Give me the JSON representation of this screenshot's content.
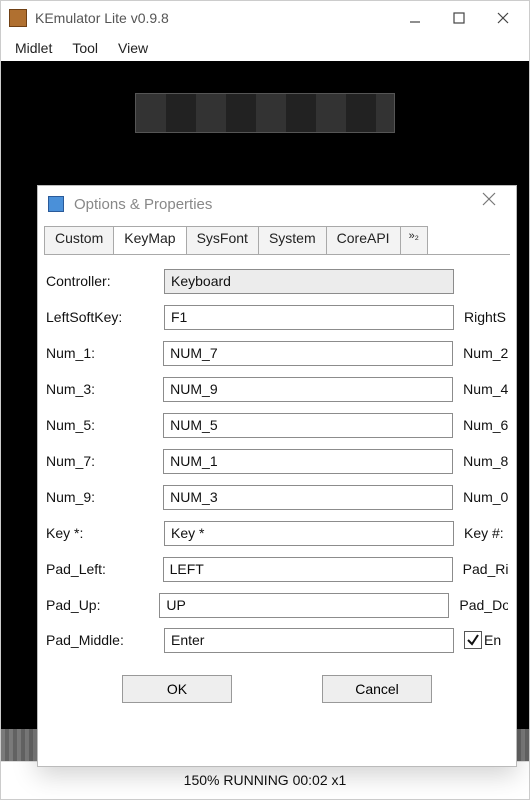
{
  "window": {
    "title": "KEmulator Lite v0.9.8"
  },
  "menubar": {
    "midlet": "Midlet",
    "tool": "Tool",
    "view": "View"
  },
  "statusbar": {
    "text": "150%  RUNNING  00:02  x1"
  },
  "dialog": {
    "title": "Options & Properties",
    "tabs": {
      "custom": "Custom",
      "keymap": "KeyMap",
      "sysfont": "SysFont",
      "system": "System",
      "coreapi": "CoreAPI",
      "more": "»₂"
    },
    "rows": {
      "controller": {
        "label": "Controller:",
        "value": "Keyboard",
        "right": ""
      },
      "leftsoftkey": {
        "label": "LeftSoftKey:",
        "value": "F1",
        "right": "RightS"
      },
      "num1": {
        "label": "Num_1:",
        "value": "NUM_7",
        "right": "Num_2"
      },
      "num3": {
        "label": "Num_3:",
        "value": "NUM_9",
        "right": "Num_4"
      },
      "num5": {
        "label": "Num_5:",
        "value": "NUM_5",
        "right": "Num_6"
      },
      "num7": {
        "label": "Num_7:",
        "value": "NUM_1",
        "right": "Num_8"
      },
      "num9": {
        "label": "Num_9:",
        "value": "NUM_3",
        "right": "Num_0"
      },
      "keystar": {
        "label": "Key *:",
        "value": "Key *",
        "right": "Key #:"
      },
      "padleft": {
        "label": "Pad_Left:",
        "value": "LEFT",
        "right": "Pad_Ri"
      },
      "padup": {
        "label": "Pad_Up:",
        "value": "UP",
        "right": "Pad_Do"
      },
      "padmiddle": {
        "label": "Pad_Middle:",
        "value": "Enter",
        "right": "En"
      }
    },
    "buttons": {
      "ok": "OK",
      "cancel": "Cancel"
    }
  }
}
